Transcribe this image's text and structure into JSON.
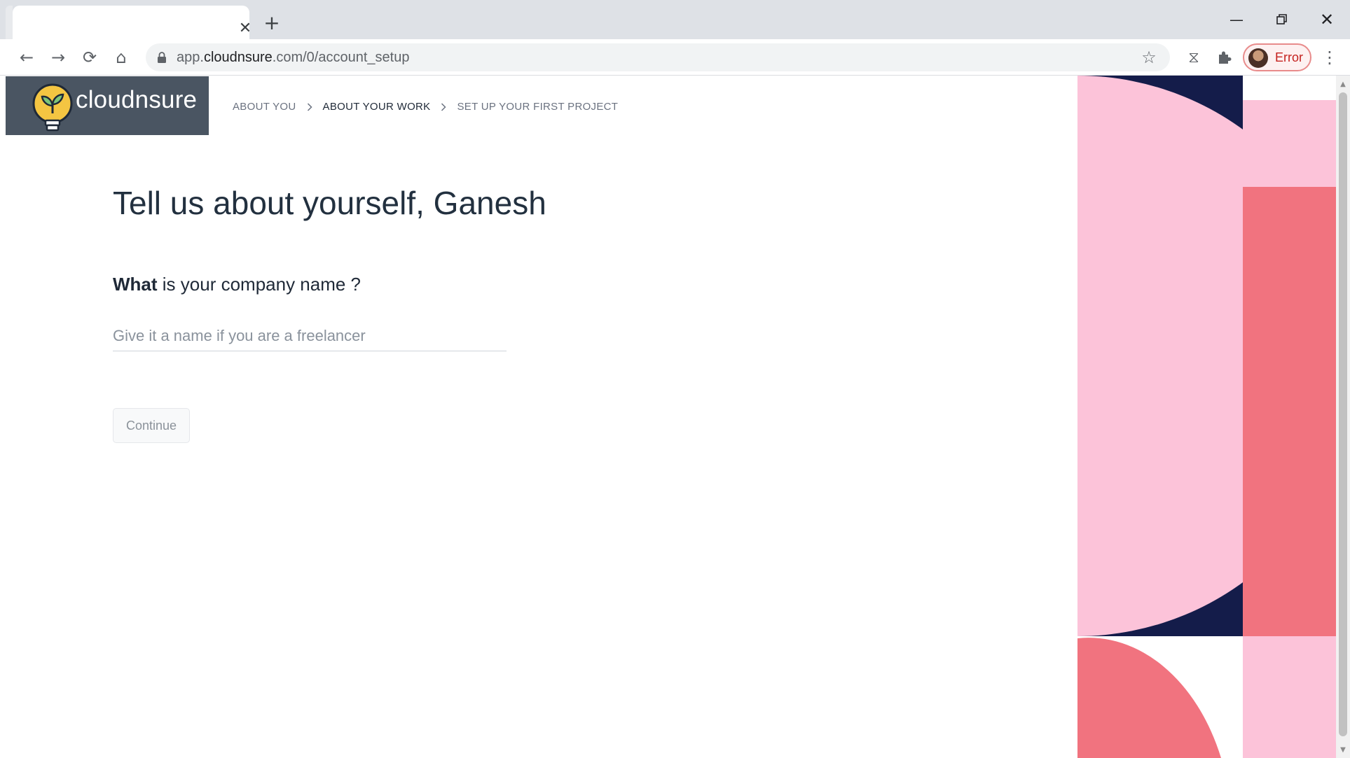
{
  "browser": {
    "tab_close_glyph": "✕",
    "new_tab_glyph": "+",
    "window_minimize_glyph": "—",
    "window_close_glyph": "✕",
    "nav": {
      "back_glyph": "←",
      "forward_glyph": "→",
      "reload_glyph": "⟳",
      "home_glyph": "⌂"
    },
    "url": {
      "prefix": "app.",
      "host": "cloudnsure",
      "path": ".com/0/account_setup"
    },
    "star_glyph": "☆",
    "sync_glyph": "⧖",
    "profile_label": "Error",
    "menu_glyph": "⋮"
  },
  "app": {
    "logo_text": "cloudnsure",
    "steps": [
      {
        "label": "About you",
        "state": "done"
      },
      {
        "label": "About your work",
        "state": "active"
      },
      {
        "label": "Set up your first project",
        "state": "upcoming"
      }
    ],
    "heading": "Tell us about yourself, Ganesh",
    "question_bold": "What",
    "question_rest": " is your company name ?",
    "input_value": "",
    "input_placeholder": "Give it a name if you are a freelancer",
    "continue_label": "Continue"
  },
  "colors": {
    "logo_bg": "#4a5562",
    "logo_bulb": "#f4c542",
    "navy": "#141c4a",
    "light_pink": "#fcc3d9",
    "coral": "#f1737f"
  }
}
